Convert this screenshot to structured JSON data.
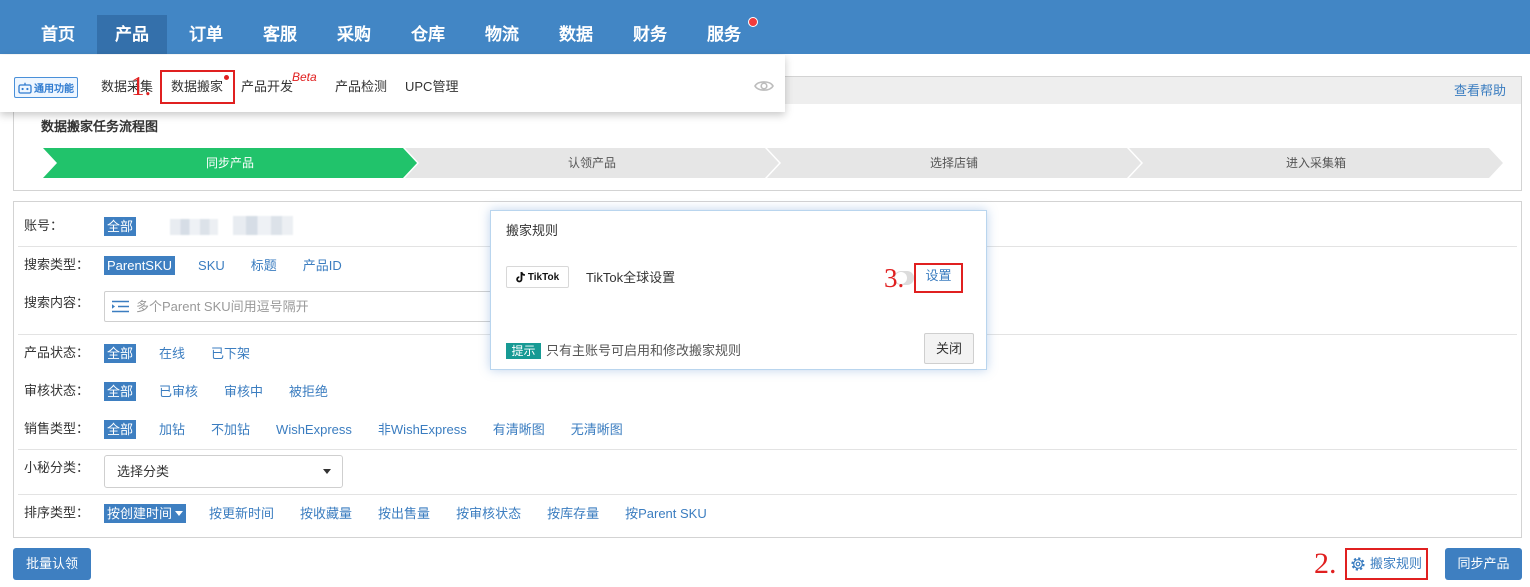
{
  "nav": {
    "items": [
      {
        "label": "首页"
      },
      {
        "label": "产品"
      },
      {
        "label": "订单"
      },
      {
        "label": "客服"
      },
      {
        "label": "采购"
      },
      {
        "label": "仓库"
      },
      {
        "label": "物流"
      },
      {
        "label": "数据"
      },
      {
        "label": "财务"
      },
      {
        "label": "服务",
        "has_notification_dot": true
      }
    ],
    "active_index": 1,
    "bar_color": "#4286c5",
    "active_color": "#3470ab"
  },
  "submenu": {
    "badge": "通用功能",
    "badge_icon": "robot-icon",
    "items": [
      {
        "label": "数据采集"
      },
      {
        "label": "数据搬家",
        "has_dot": true
      },
      {
        "label": "产品开发",
        "tag": "Beta"
      },
      {
        "label": "产品检测"
      },
      {
        "label": "UPC管理"
      }
    ],
    "visibility_icon": "eye-icon"
  },
  "annotations": [
    {
      "text": "1."
    },
    {
      "text": "2."
    },
    {
      "text": "3."
    }
  ],
  "help_link": "查看帮助",
  "flow": {
    "title": "数据搬家任务流程图",
    "steps": [
      {
        "label": "同步产品",
        "active": true
      },
      {
        "label": "认领产品",
        "active": false
      },
      {
        "label": "选择店铺",
        "active": false
      },
      {
        "label": "进入采集箱",
        "active": false
      }
    ]
  },
  "filters": {
    "account": {
      "label": "账号：",
      "options": [
        "全部"
      ],
      "selected_index": 0
    },
    "search_type": {
      "label": "搜索类型：",
      "options": [
        "ParentSKU",
        "SKU",
        "标题",
        "产品ID"
      ],
      "selected_index": 0
    },
    "search_content": {
      "label": "搜索内容：",
      "value": "",
      "placeholder": "多个Parent SKU间用逗号隔开",
      "icon": "list-icon"
    },
    "product_status": {
      "label": "产品状态：",
      "options": [
        "全部",
        "在线",
        "已下架"
      ],
      "selected_index": 0
    },
    "review_status": {
      "label": "审核状态：",
      "options": [
        "全部",
        "已审核",
        "审核中",
        "被拒绝"
      ],
      "selected_index": 0
    },
    "sale_type": {
      "label": "销售类型：",
      "options": [
        "全部",
        "加钻",
        "不加钻",
        "WishExpress",
        "非WishExpress",
        "有清晰图",
        "无清晰图"
      ],
      "selected_index": 0
    },
    "category": {
      "label": "小秘分类：",
      "value": "选择分类"
    },
    "sort_type": {
      "label": "排序类型：",
      "options": [
        "按创建时间",
        "按更新时间",
        "按收藏量",
        "按出售量",
        "按审核状态",
        "按库存量",
        "按Parent SKU"
      ],
      "selected_index": 0
    }
  },
  "actions": {
    "bulk_claim": "批量认领",
    "move_rules": "搬家规则",
    "move_rules_icon": "gear-icon",
    "sync_products": "同步产品"
  },
  "modal": {
    "title": "搬家规则",
    "rules": [
      {
        "platform_logo": "TikTok",
        "name": "TikTok全球设置",
        "enabled": false,
        "action": "设置"
      }
    ],
    "tip_badge": "提示",
    "tip_text": "只有主账号可启用和修改搬家规则",
    "close_label": "关闭"
  },
  "colors": {
    "link": "#3b7dc0",
    "selected_bg": "#3e7fc1",
    "button_bg": "#3e7fc1",
    "step_active": "#21c36b",
    "step_inactive": "#e6e6e6",
    "tip_bg": "#179a94",
    "annotation": "#e02020"
  }
}
